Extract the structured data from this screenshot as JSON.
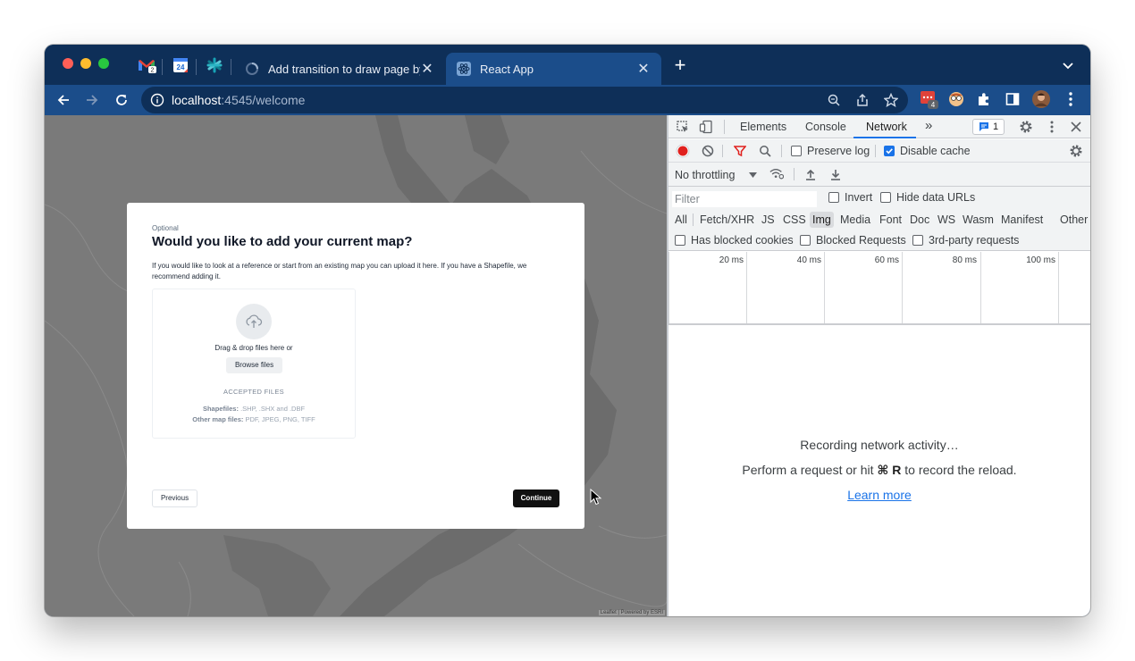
{
  "browser": {
    "tabs": [
      {
        "title": "Add transition to draw page by",
        "active": false
      },
      {
        "title": "React App",
        "active": true
      }
    ],
    "pinned_tabs": [
      "gmail-icon",
      "calendar-icon",
      "asterisk-app-icon"
    ],
    "gmail_badge": "2",
    "calendar_badge": "24",
    "close_glyph": "✕",
    "new_tab_glyph": "+",
    "url_host": "localhost",
    "url_rest": ":4545/welcome",
    "extension_badge": "4",
    "colors": {
      "frame": "#0e2f58",
      "toolbar": "#1b4d8a",
      "accent": "#1a73e8"
    }
  },
  "modal": {
    "optional": "Optional",
    "title": "Would you like to add your current map?",
    "description": "If you would like to look at a reference or start from an existing map you can upload it here. If you have a Shapefile, we recommend adding it.",
    "drag_text": "Drag & drop files here or",
    "browse_label": "Browse files",
    "accepted_heading": "ACCEPTED FILES",
    "shapefiles_label": "Shapefiles:",
    "shapefiles_value": ".SHP, .SHX and .DBF",
    "other_label": "Other map files:",
    "other_value": "PDF, JPEG, PNG, TIFF",
    "previous_label": "Previous",
    "continue_label": "Continue"
  },
  "map": {
    "attribution": "Leaflet | Powered by ESRI"
  },
  "devtools": {
    "tabs": [
      "Elements",
      "Console",
      "Network"
    ],
    "active_tab": "Network",
    "more_tabs": "»",
    "issues_count": "1",
    "preserve_log": "Preserve log",
    "preserve_log_checked": false,
    "disable_cache": "Disable cache",
    "disable_cache_checked": true,
    "throttling": "No throttling",
    "filter_placeholder": "Filter",
    "invert": "Invert",
    "hide_data_urls": "Hide data URLs",
    "types": [
      "All",
      "Fetch/XHR",
      "JS",
      "CSS",
      "Img",
      "Media",
      "Font",
      "Doc",
      "WS",
      "Wasm",
      "Manifest",
      "Other"
    ],
    "selected_type": "Img",
    "has_blocked_cookies": "Has blocked cookies",
    "blocked_requests": "Blocked Requests",
    "third_party": "3rd-party requests",
    "timeline_ticks": [
      "20 ms",
      "40 ms",
      "60 ms",
      "80 ms",
      "100 ms"
    ],
    "empty_title": "Recording network activity…",
    "empty_hint_prefix": "Perform a request or hit",
    "empty_hint_key": "⌘ R",
    "empty_hint_suffix": "to record the reload.",
    "learn_more": "Learn more"
  }
}
